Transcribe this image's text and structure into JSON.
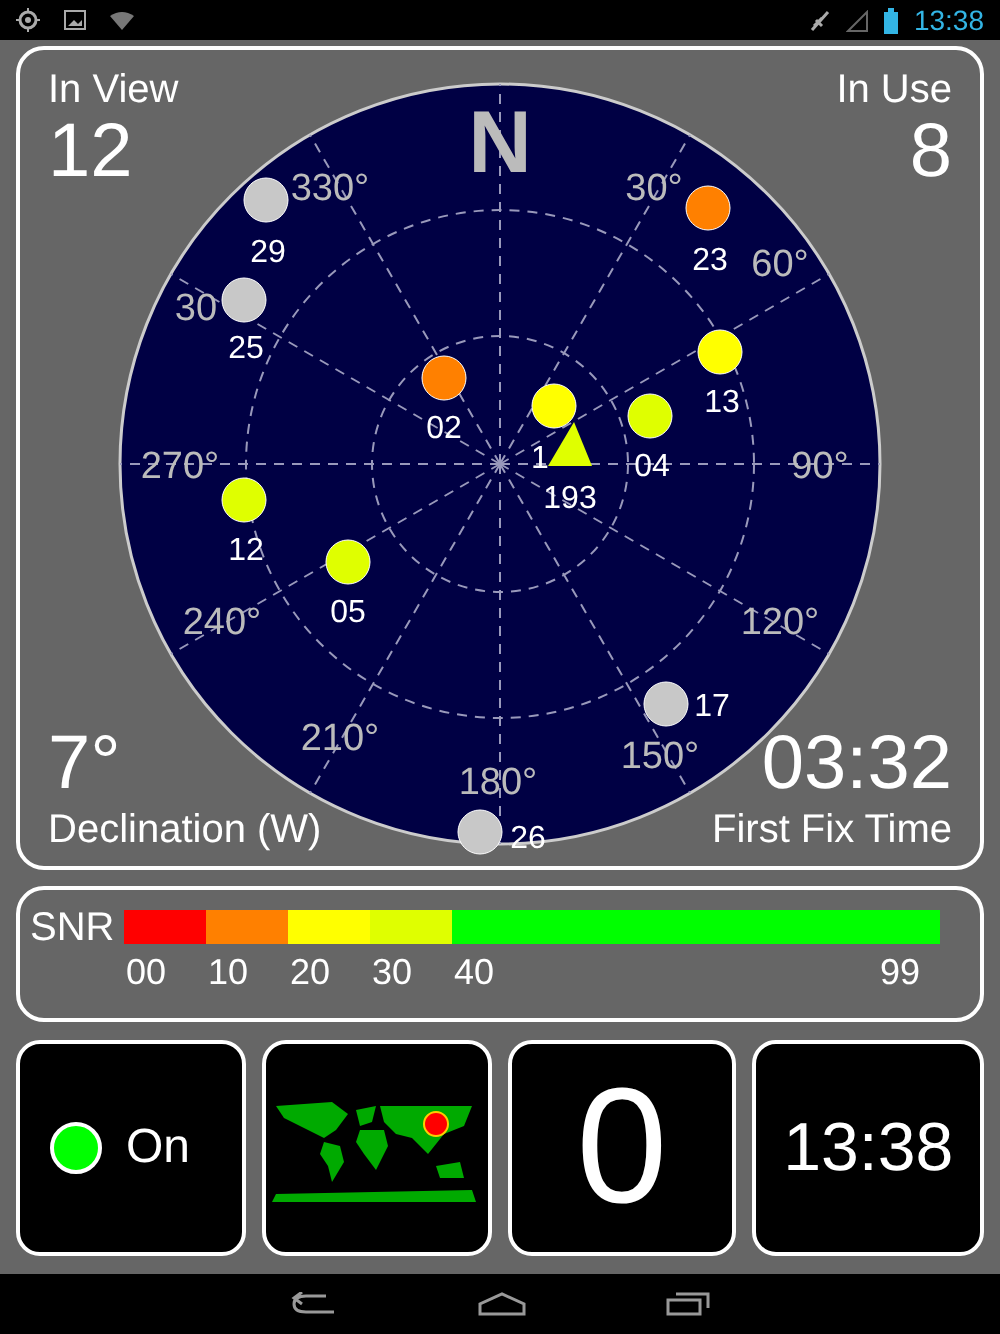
{
  "status_bar": {
    "time": "13:38"
  },
  "radar": {
    "in_view_label": "In View",
    "in_view": "12",
    "in_use_label": "In Use",
    "in_use": "8",
    "north": "N",
    "degree_labels": [
      "330°",
      "30°",
      "30",
      "60°",
      "270°",
      "90°",
      "240°",
      "120°",
      "210°",
      "150°",
      "180°"
    ],
    "satellites": [
      {
        "id": "29",
        "kind": "circle",
        "color": "#c8c8c8"
      },
      {
        "id": "25",
        "kind": "circle",
        "color": "#c8c8c8"
      },
      {
        "id": "23",
        "kind": "circle",
        "color": "#ff8000"
      },
      {
        "id": "13",
        "kind": "circle",
        "color": "#ffff00"
      },
      {
        "id": "02",
        "kind": "circle",
        "color": "#ff8000"
      },
      {
        "id": "1",
        "kind": "circle",
        "color": "#ffff00"
      },
      {
        "id": "04",
        "kind": "circle",
        "color": "#dfff00"
      },
      {
        "id": "193",
        "kind": "triangle",
        "color": "#dfff00"
      },
      {
        "id": "12",
        "kind": "circle",
        "color": "#dfff00"
      },
      {
        "id": "05",
        "kind": "circle",
        "color": "#dfff00"
      },
      {
        "id": "17",
        "kind": "circle",
        "color": "#c8c8c8"
      },
      {
        "id": "26",
        "kind": "circle",
        "color": "#c8c8c8"
      }
    ],
    "declination": "7°",
    "declination_label": "Declination (W)",
    "first_fix": "03:32",
    "first_fix_label": "First Fix Time"
  },
  "snr": {
    "label": "SNR",
    "scale": [
      {
        "label": "00",
        "color": "#ff0000"
      },
      {
        "label": "10",
        "color": "#ff8000"
      },
      {
        "label": "20",
        "color": "#ffff00"
      },
      {
        "label": "30",
        "color": "#dfff00"
      },
      {
        "label": "40",
        "color": "#00ff00"
      }
    ],
    "max_label": "99"
  },
  "tiles": {
    "gps_on": true,
    "gps_status": "On",
    "count": "0",
    "clock": "13:38"
  }
}
